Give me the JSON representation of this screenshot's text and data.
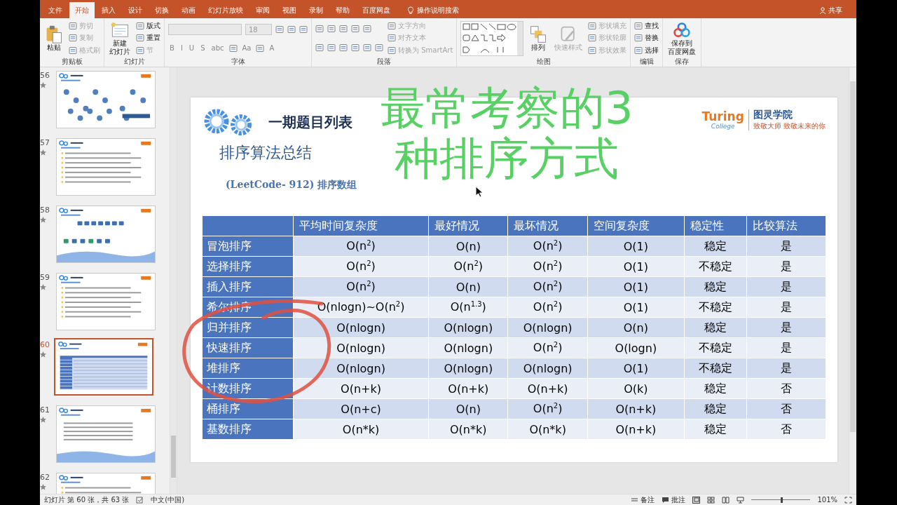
{
  "tabs": [
    {
      "label": "文件",
      "selected": false
    },
    {
      "label": "开始",
      "selected": true
    },
    {
      "label": "插入",
      "selected": false
    },
    {
      "label": "设计",
      "selected": false
    },
    {
      "label": "切换",
      "selected": false
    },
    {
      "label": "动画",
      "selected": false
    },
    {
      "label": "幻灯片放映",
      "selected": false
    },
    {
      "label": "审阅",
      "selected": false
    },
    {
      "label": "视图",
      "selected": false
    },
    {
      "label": "录制",
      "selected": false
    },
    {
      "label": "帮助",
      "selected": false
    },
    {
      "label": "百度网盘",
      "selected": false
    }
  ],
  "tell_me": "操作说明搜索",
  "share": "共享",
  "ribbon": {
    "groups": [
      {
        "label": "剪贴板",
        "columns": [
          [
            {
              "kind": "large",
              "label": "粘贴",
              "disabled": false
            }
          ],
          [
            {
              "kind": "small",
              "label": "剪切",
              "disabled": true
            },
            {
              "kind": "small",
              "label": "复制",
              "disabled": true
            },
            {
              "kind": "small",
              "label": "格式刷",
              "disabled": true
            }
          ]
        ]
      },
      {
        "label": "幻灯片",
        "columns": [
          [
            {
              "kind": "large",
              "lines": [
                "新建",
                "幻灯片"
              ],
              "disabled": false
            }
          ],
          [
            {
              "kind": "small",
              "label": "版式",
              "disabled": false
            },
            {
              "kind": "small",
              "label": "重置",
              "disabled": false
            },
            {
              "kind": "small",
              "label": "节",
              "disabled": true
            }
          ]
        ]
      },
      {
        "label": "字体",
        "columns": [
          [
            {
              "kind": "row",
              "items": [
                {
                  "kind": "field"
                },
                {
                  "kind": "field",
                  "value": "18"
                },
                {
                  "kind": "icon"
                },
                {
                  "kind": "icon"
                },
                {
                  "kind": "icon"
                }
              ]
            },
            {
              "kind": "row",
              "items": [
                {
                  "kind": "text",
                  "label": "B"
                },
                {
                  "kind": "text",
                  "label": "I"
                },
                {
                  "kind": "text",
                  "label": "U"
                },
                {
                  "kind": "text",
                  "label": "S"
                },
                {
                  "kind": "text",
                  "label": "abc"
                },
                {
                  "kind": "icon"
                },
                {
                  "kind": "text",
                  "label": "Aa"
                },
                {
                  "kind": "icon"
                },
                {
                  "kind": "text",
                  "label": "A"
                }
              ]
            }
          ]
        ]
      },
      {
        "label": "段落",
        "columns": [
          [
            {
              "kind": "row",
              "items": [
                {
                  "kind": "icon"
                },
                {
                  "kind": "icon"
                },
                {
                  "kind": "icon"
                },
                {
                  "kind": "icon"
                },
                {
                  "kind": "icon"
                }
              ]
            },
            {
              "kind": "row",
              "items": [
                {
                  "kind": "icon"
                },
                {
                  "kind": "icon"
                },
                {
                  "kind": "icon"
                },
                {
                  "kind": "icon"
                },
                {
                  "kind": "icon"
                },
                {
                  "kind": "icon"
                }
              ]
            }
          ],
          [
            {
              "kind": "small",
              "label": "文字方向",
              "disabled": true
            },
            {
              "kind": "small",
              "label": "对齐文本",
              "disabled": true
            },
            {
              "kind": "small",
              "label": "转换为 SmartArt",
              "disabled": true
            }
          ]
        ]
      },
      {
        "label": "绘图",
        "columns": [
          [
            {
              "kind": "gallery"
            }
          ],
          [
            {
              "kind": "large",
              "label": "排列",
              "disabled": false
            }
          ],
          [
            {
              "kind": "large",
              "label": "快速样式",
              "disabled": true
            }
          ],
          [
            {
              "kind": "small",
              "label": "形状填充",
              "disabled": true
            },
            {
              "kind": "small",
              "label": "形状轮廓",
              "disabled": true
            },
            {
              "kind": "small",
              "label": "形状效果",
              "disabled": true
            }
          ]
        ]
      },
      {
        "label": "编辑",
        "columns": [
          [
            {
              "kind": "small",
              "label": "查找",
              "disabled": false
            },
            {
              "kind": "small",
              "label": "替换",
              "disabled": false
            },
            {
              "kind": "small",
              "label": "选择",
              "disabled": false
            }
          ]
        ]
      },
      {
        "label": "保存",
        "columns": [
          [
            {
              "kind": "large",
              "lines": [
                "保存到",
                "百度网盘"
              ],
              "disabled": false
            }
          ]
        ]
      }
    ]
  },
  "thumbnails": [
    {
      "number": "56",
      "kind": "tree",
      "selected": false
    },
    {
      "number": "57",
      "kind": "text",
      "selected": false
    },
    {
      "number": "58",
      "kind": "blocks",
      "selected": false
    },
    {
      "number": "59",
      "kind": "text",
      "selected": false
    },
    {
      "number": "60",
      "kind": "table",
      "selected": true
    },
    {
      "number": "61",
      "kind": "wave",
      "selected": false
    },
    {
      "number": "62",
      "kind": "text",
      "selected": false
    }
  ],
  "slide": {
    "title": "一期题目列表",
    "subtitle": "排序算法总结",
    "problem": "(LeetCode- 912) 排序数组",
    "logo": {
      "wordmark": "Turing",
      "sub": "College",
      "name": "图灵学院",
      "tagline": "致敬大师 致敬未来的你"
    },
    "table": {
      "columns": [
        "",
        "平均时间复杂度",
        "最好情况",
        "最坏情况",
        "空间复杂度",
        "稳定性",
        "比较算法"
      ],
      "rows": [
        {
          "cells": [
            "冒泡排序",
            "O(n$^{2}$)",
            "O(n)",
            "O(n$^{2}$)",
            "O(1)",
            "稳定",
            "是"
          ]
        },
        {
          "cells": [
            "选择排序",
            "O(n$^{2}$)",
            "O(n$^{2}$)",
            "O(n$^{2}$)",
            "O(1)",
            "不稳定",
            "是"
          ]
        },
        {
          "cells": [
            "插入排序",
            "O(n$^{2}$)",
            "O(n)",
            "O(n$^{2}$)",
            "O(1)",
            "稳定",
            "是"
          ]
        },
        {
          "cells": [
            "希尔排序",
            "O(nlogn)~O(n$^{2}$)",
            "O(n$^{1.3}$)",
            "O(n$^{2}$)",
            "O(1)",
            "不稳定",
            "是"
          ]
        },
        {
          "cells": [
            "归并排序",
            "O(nlogn)",
            "O(nlogn)",
            "O(nlogn)",
            "O(n)",
            "稳定",
            "是"
          ]
        },
        {
          "cells": [
            "快速排序",
            "O(nlogn)",
            "O(nlogn)",
            "O(n$^{2}$)",
            "O(logn)",
            "不稳定",
            "是"
          ]
        },
        {
          "cells": [
            "堆排序",
            "O(nlogn)",
            "O(nlogn)",
            "O(nlogn)",
            "O(1)",
            "不稳定",
            "是"
          ]
        },
        {
          "cells": [
            "计数排序",
            "O(n+k)",
            "O(n+k)",
            "O(n+k)",
            "O(k)",
            "稳定",
            "否"
          ]
        },
        {
          "cells": [
            "桶排序",
            "O(n+c)",
            "O(n)",
            "O(n$^{2}$)",
            "O(n+k)",
            "稳定",
            "否"
          ]
        },
        {
          "cells": [
            "基数排序",
            "O(n*k)",
            "O(n*k)",
            "O(n*k)",
            "O(n+k)",
            "稳定",
            "否"
          ]
        }
      ]
    }
  },
  "overlay": {
    "lines": [
      "最常考察的3",
      "种排序方式"
    ]
  },
  "status_bar": {
    "position": "幻灯片 第 60 张，共 63 张",
    "language": "中文(中国)",
    "notes": "备注",
    "comments": "批注",
    "zoom": {
      "level": 0.5
    },
    "zoom_reading": "101%"
  }
}
